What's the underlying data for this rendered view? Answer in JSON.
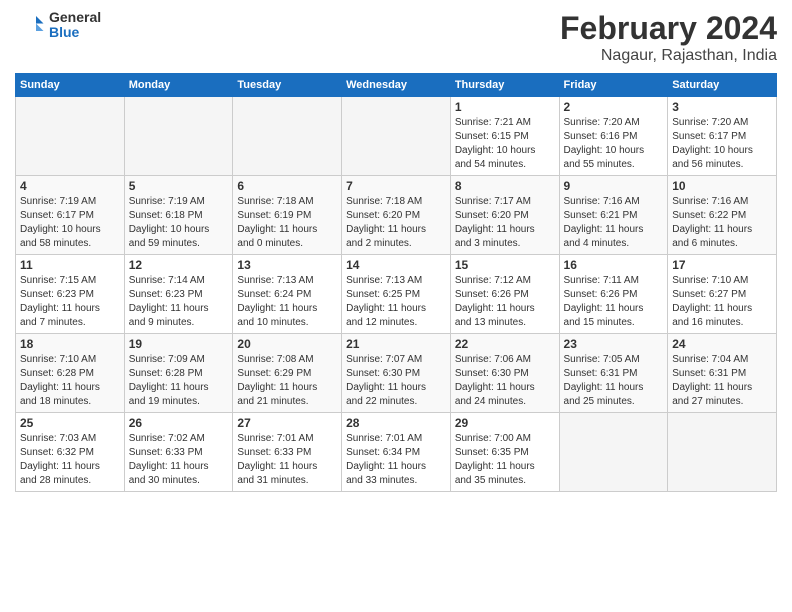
{
  "app": {
    "logo_general": "General",
    "logo_blue": "Blue"
  },
  "header": {
    "month": "February 2024",
    "location": "Nagaur, Rajasthan, India"
  },
  "weekdays": [
    "Sunday",
    "Monday",
    "Tuesday",
    "Wednesday",
    "Thursday",
    "Friday",
    "Saturday"
  ],
  "weeks": [
    [
      {
        "day": "",
        "info": ""
      },
      {
        "day": "",
        "info": ""
      },
      {
        "day": "",
        "info": ""
      },
      {
        "day": "",
        "info": ""
      },
      {
        "day": "1",
        "info": "Sunrise: 7:21 AM\nSunset: 6:15 PM\nDaylight: 10 hours\nand 54 minutes."
      },
      {
        "day": "2",
        "info": "Sunrise: 7:20 AM\nSunset: 6:16 PM\nDaylight: 10 hours\nand 55 minutes."
      },
      {
        "day": "3",
        "info": "Sunrise: 7:20 AM\nSunset: 6:17 PM\nDaylight: 10 hours\nand 56 minutes."
      }
    ],
    [
      {
        "day": "4",
        "info": "Sunrise: 7:19 AM\nSunset: 6:17 PM\nDaylight: 10 hours\nand 58 minutes."
      },
      {
        "day": "5",
        "info": "Sunrise: 7:19 AM\nSunset: 6:18 PM\nDaylight: 10 hours\nand 59 minutes."
      },
      {
        "day": "6",
        "info": "Sunrise: 7:18 AM\nSunset: 6:19 PM\nDaylight: 11 hours\nand 0 minutes."
      },
      {
        "day": "7",
        "info": "Sunrise: 7:18 AM\nSunset: 6:20 PM\nDaylight: 11 hours\nand 2 minutes."
      },
      {
        "day": "8",
        "info": "Sunrise: 7:17 AM\nSunset: 6:20 PM\nDaylight: 11 hours\nand 3 minutes."
      },
      {
        "day": "9",
        "info": "Sunrise: 7:16 AM\nSunset: 6:21 PM\nDaylight: 11 hours\nand 4 minutes."
      },
      {
        "day": "10",
        "info": "Sunrise: 7:16 AM\nSunset: 6:22 PM\nDaylight: 11 hours\nand 6 minutes."
      }
    ],
    [
      {
        "day": "11",
        "info": "Sunrise: 7:15 AM\nSunset: 6:23 PM\nDaylight: 11 hours\nand 7 minutes."
      },
      {
        "day": "12",
        "info": "Sunrise: 7:14 AM\nSunset: 6:23 PM\nDaylight: 11 hours\nand 9 minutes."
      },
      {
        "day": "13",
        "info": "Sunrise: 7:13 AM\nSunset: 6:24 PM\nDaylight: 11 hours\nand 10 minutes."
      },
      {
        "day": "14",
        "info": "Sunrise: 7:13 AM\nSunset: 6:25 PM\nDaylight: 11 hours\nand 12 minutes."
      },
      {
        "day": "15",
        "info": "Sunrise: 7:12 AM\nSunset: 6:26 PM\nDaylight: 11 hours\nand 13 minutes."
      },
      {
        "day": "16",
        "info": "Sunrise: 7:11 AM\nSunset: 6:26 PM\nDaylight: 11 hours\nand 15 minutes."
      },
      {
        "day": "17",
        "info": "Sunrise: 7:10 AM\nSunset: 6:27 PM\nDaylight: 11 hours\nand 16 minutes."
      }
    ],
    [
      {
        "day": "18",
        "info": "Sunrise: 7:10 AM\nSunset: 6:28 PM\nDaylight: 11 hours\nand 18 minutes."
      },
      {
        "day": "19",
        "info": "Sunrise: 7:09 AM\nSunset: 6:28 PM\nDaylight: 11 hours\nand 19 minutes."
      },
      {
        "day": "20",
        "info": "Sunrise: 7:08 AM\nSunset: 6:29 PM\nDaylight: 11 hours\nand 21 minutes."
      },
      {
        "day": "21",
        "info": "Sunrise: 7:07 AM\nSunset: 6:30 PM\nDaylight: 11 hours\nand 22 minutes."
      },
      {
        "day": "22",
        "info": "Sunrise: 7:06 AM\nSunset: 6:30 PM\nDaylight: 11 hours\nand 24 minutes."
      },
      {
        "day": "23",
        "info": "Sunrise: 7:05 AM\nSunset: 6:31 PM\nDaylight: 11 hours\nand 25 minutes."
      },
      {
        "day": "24",
        "info": "Sunrise: 7:04 AM\nSunset: 6:31 PM\nDaylight: 11 hours\nand 27 minutes."
      }
    ],
    [
      {
        "day": "25",
        "info": "Sunrise: 7:03 AM\nSunset: 6:32 PM\nDaylight: 11 hours\nand 28 minutes."
      },
      {
        "day": "26",
        "info": "Sunrise: 7:02 AM\nSunset: 6:33 PM\nDaylight: 11 hours\nand 30 minutes."
      },
      {
        "day": "27",
        "info": "Sunrise: 7:01 AM\nSunset: 6:33 PM\nDaylight: 11 hours\nand 31 minutes."
      },
      {
        "day": "28",
        "info": "Sunrise: 7:01 AM\nSunset: 6:34 PM\nDaylight: 11 hours\nand 33 minutes."
      },
      {
        "day": "29",
        "info": "Sunrise: 7:00 AM\nSunset: 6:35 PM\nDaylight: 11 hours\nand 35 minutes."
      },
      {
        "day": "",
        "info": ""
      },
      {
        "day": "",
        "info": ""
      }
    ]
  ]
}
